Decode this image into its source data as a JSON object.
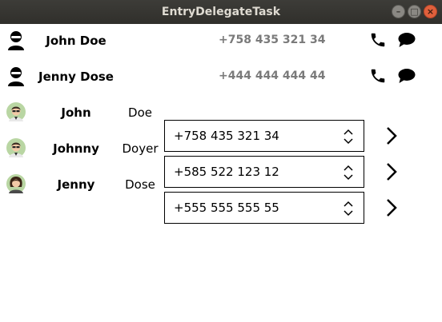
{
  "window": {
    "title": "EntryDelegateTask"
  },
  "simple_rows": [
    {
      "name": "John Doe",
      "phone": "+758 435 321 34"
    },
    {
      "name": "Jenny Dose",
      "phone": "+444 444 444 44"
    }
  ],
  "delegate_rows": [
    {
      "first_name": "John",
      "last_name": "Doe",
      "phone": "+758 435 321 34"
    },
    {
      "first_name": "Johnny",
      "last_name": "Doyer",
      "phone": "+585 522 123 12"
    },
    {
      "first_name": "Jenny",
      "last_name": "Dose",
      "phone": "+555 555 555 55"
    }
  ],
  "icons": {
    "simple_avatar": "person-silhouette-icon",
    "call": "phone-icon",
    "message": "chat-bubble-icon",
    "spin": "up-down-arrows-icon",
    "open": "chevron-right-icon"
  }
}
